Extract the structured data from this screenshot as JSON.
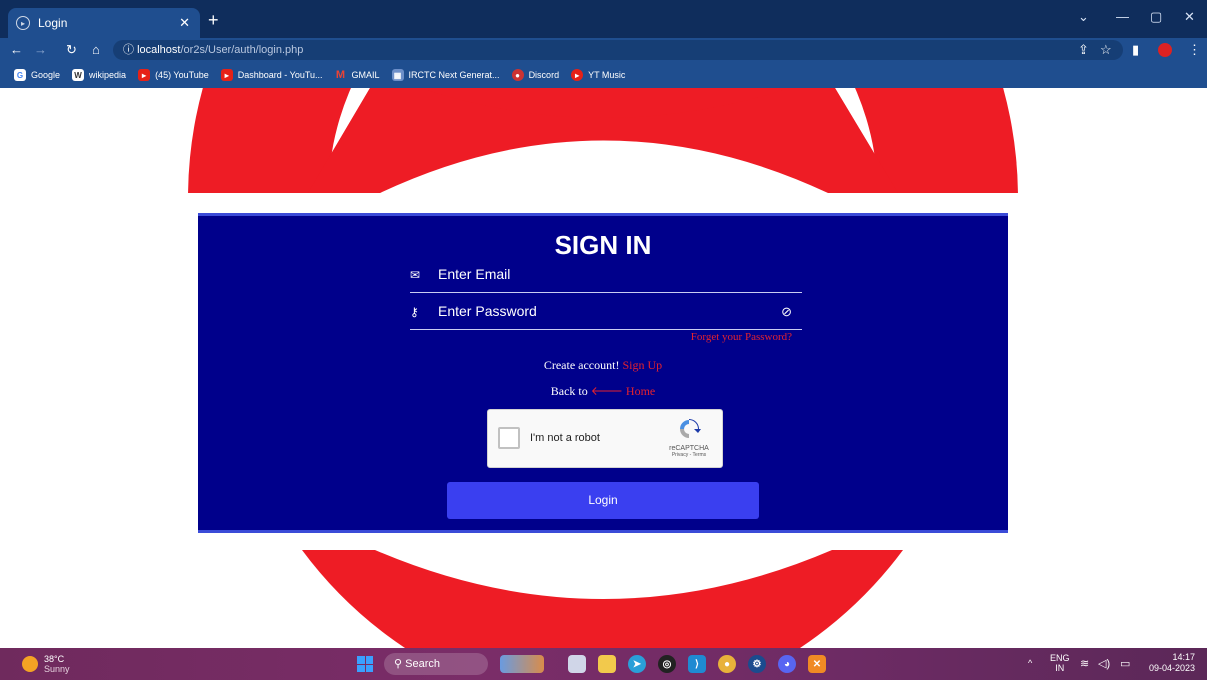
{
  "browser": {
    "tab_title": "Login",
    "url_host": "localhost",
    "url_path": "/or2s/User/auth/login.php",
    "bookmarks": [
      "Google",
      "wikipedia",
      "(45) YouTube",
      "Dashboard - YouTu...",
      "GMAIL",
      "IRCTC Next Generat...",
      "Discord",
      "YT Music"
    ]
  },
  "login": {
    "title": "SIGN IN",
    "email_placeholder": "Enter Email",
    "password_placeholder": "Enter Password",
    "forget": "Forget your Password?",
    "create_text": "Create account!",
    "signup": "Sign Up",
    "back_text": "Back to",
    "home": "Home",
    "captcha_text": "I'm not a robot",
    "captcha_brand": "reCAPTCHA",
    "captcha_terms": "Privacy - Terms",
    "login_button": "Login"
  },
  "taskbar": {
    "temperature": "38°C",
    "weather": "Sunny",
    "search": "Search",
    "lang": "ENG",
    "region": "IN",
    "time": "14:17",
    "date": "09-04-2023"
  },
  "colors": {
    "card_bg": "#00008b",
    "accent_red": "#e4222e",
    "button": "#3a3ff0"
  }
}
